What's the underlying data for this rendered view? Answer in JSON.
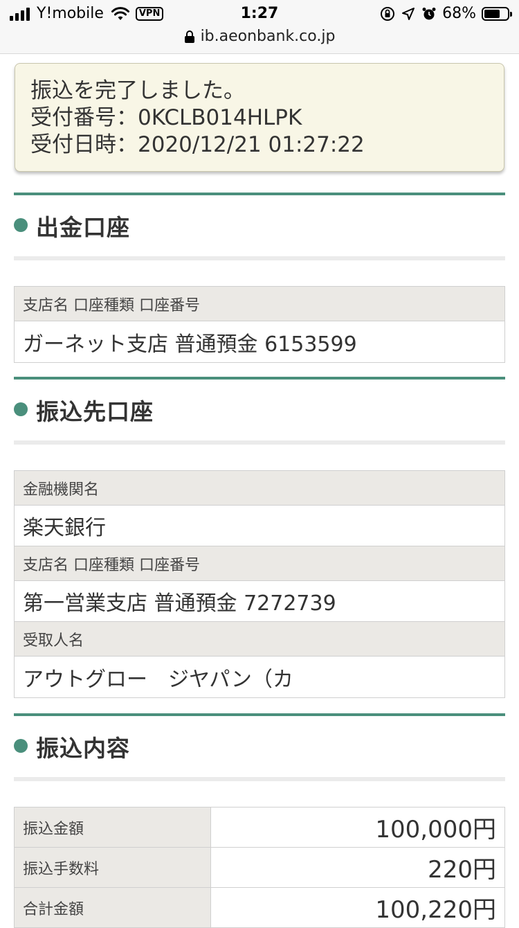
{
  "status_bar": {
    "carrier": "Y!mobile",
    "vpn": "VPN",
    "time": "1:27",
    "battery": "68%",
    "battery_level": 0.68
  },
  "url_bar": {
    "url": "ib.aeonbank.co.jp"
  },
  "completion": {
    "message": "振込を完了しました。",
    "reception_number": "受付番号：0KCLB014HLPK",
    "reception_datetime": "受付日時：2020/12/21 01:27:22"
  },
  "source_account": {
    "heading": "出金口座",
    "label": "支店名 口座種類 口座番号",
    "value": "ガーネット支店 普通預金 6153599"
  },
  "destination_account": {
    "heading": "振込先口座",
    "bank_label": "金融機関名",
    "bank_value": "楽天銀行",
    "branch_label": "支店名 口座種類 口座番号",
    "branch_value": "第一営業支店 普通預金 7272739",
    "recipient_label": "受取人名",
    "recipient_value": "アウトグロー　ジヤパン（カ"
  },
  "transfer_details": {
    "heading": "振込内容",
    "rows": [
      {
        "label": "振込金額",
        "value": "100,000円"
      },
      {
        "label": "振込手数料",
        "value": "220円"
      },
      {
        "label": "合計金額",
        "value": "100,220円"
      }
    ]
  },
  "colors": {
    "accent": "#4a8f7c",
    "notice_bg": "#f8f6e6",
    "label_bg": "#ebe9e5"
  }
}
